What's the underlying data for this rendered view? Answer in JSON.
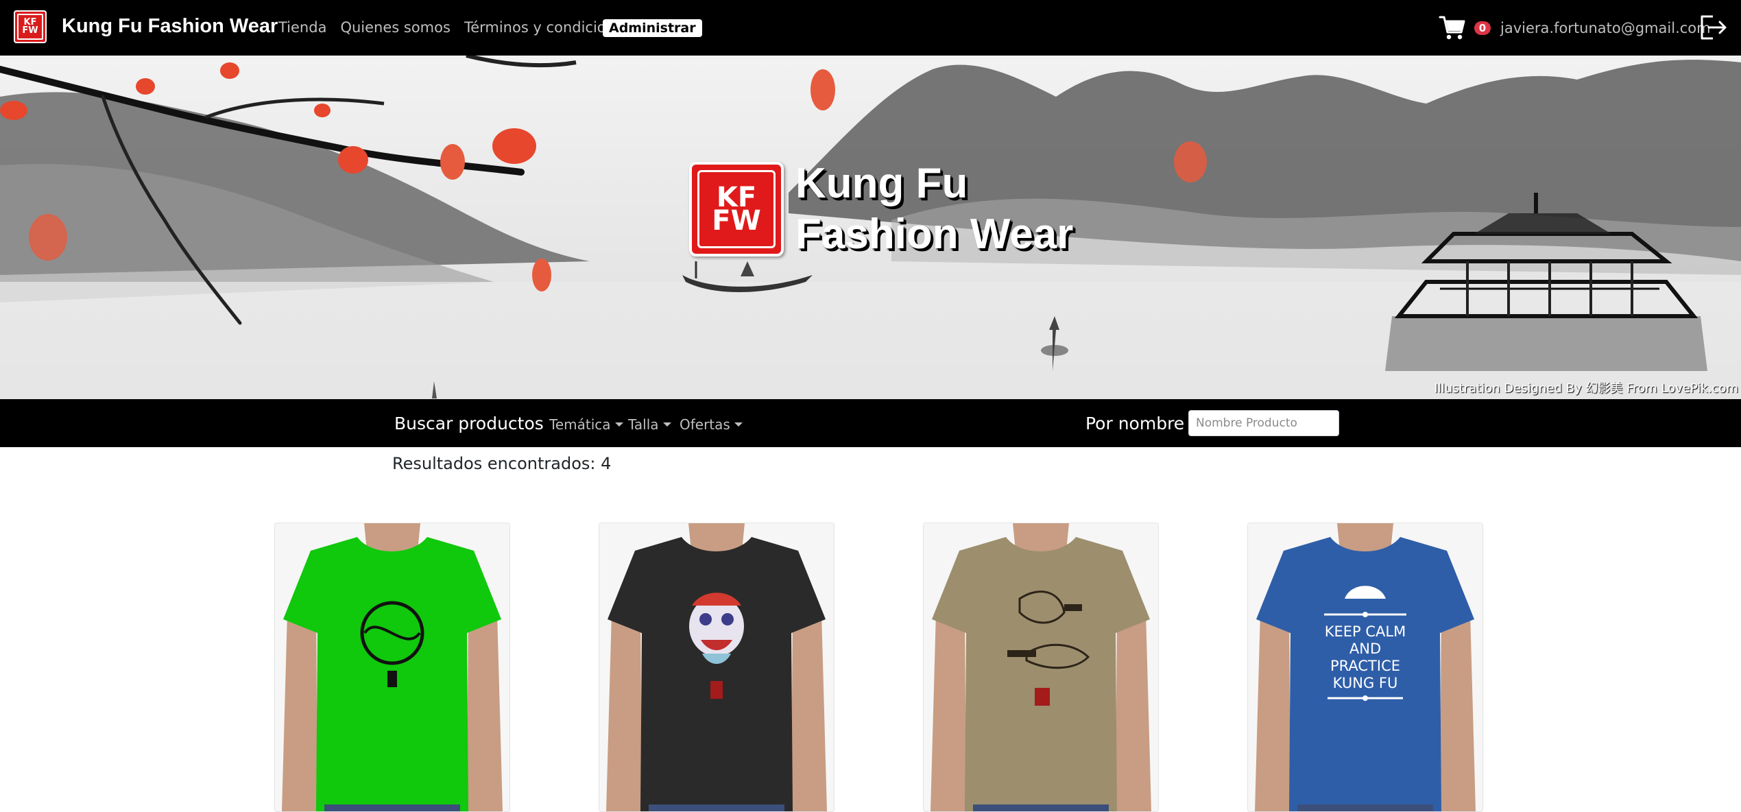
{
  "navbar": {
    "logo_letters": [
      "K",
      "F",
      "F",
      "W"
    ],
    "brand": "Kung Fu Fashion Wear",
    "links": [
      "Tienda",
      "Quienes somos",
      "Términos y condiciones"
    ],
    "admin_label": "Administrar",
    "cart_icon": "shopping-cart-icon",
    "cart_count": "0",
    "user_email": "javiera.fortunato@gmail.com",
    "logout_icon": "logout-icon"
  },
  "hero": {
    "logo_letters": [
      "K",
      "F",
      "F",
      "W"
    ],
    "title_line1": "Kung Fu",
    "title_line2": "Fashion Wear",
    "credit": "Illustration Designed By 幻影美 From LovePik.com"
  },
  "search": {
    "title": "Buscar productos",
    "filters": [
      "Temática",
      "Talla",
      "Ofertas"
    ],
    "by_name_label": "Por nombre",
    "input_placeholder": "Nombre Producto",
    "input_value": ""
  },
  "results": {
    "text": "Resultados encontrados: 4"
  },
  "products": [
    {
      "shirt_color": "#10c80c",
      "design": "yin-yang-dragon"
    },
    {
      "shirt_color": "#2a2a2a",
      "design": "lion-dance-head"
    },
    {
      "shirt_color": "#9d8e6d",
      "design": "fung-chop-choy"
    },
    {
      "shirt_color": "#2f5ea8",
      "design": "keep-calm-kung-fu",
      "design_text": [
        "KEEP CALM",
        "AND",
        "PRACTICE",
        "KUNG FU"
      ]
    }
  ],
  "colors": {
    "nav_bg": "#000000",
    "badge": "#dc3545",
    "logo_red": "#e01a1a"
  }
}
